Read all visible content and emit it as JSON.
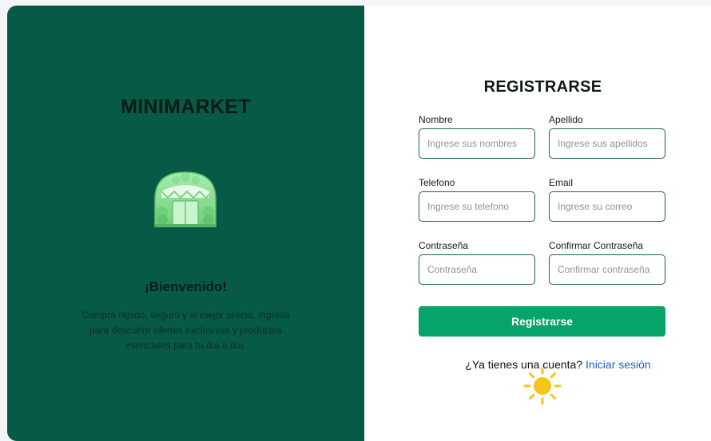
{
  "brand": {
    "name": "MINIMARKET",
    "welcome": "¡Bienvenido!",
    "description": "Compra rápido, seguro y al mejor precio. Ingresa para descubrir ofertas exclusivas y productos esenciales para tu día a día.",
    "illustration": "storefront-icon"
  },
  "form": {
    "title": "REGISTRARSE",
    "fields": [
      {
        "label": "Nombre",
        "placeholder": "Ingrese sus nombres",
        "value": ""
      },
      {
        "label": "Apellido",
        "placeholder": "Ingrese sus apellidos",
        "value": ""
      },
      {
        "label": "Telefono",
        "placeholder": "Ingrese su telefono",
        "value": ""
      },
      {
        "label": "Email",
        "placeholder": "Ingrese su correo",
        "value": ""
      },
      {
        "label": "Contraseña",
        "placeholder": "Contraseña",
        "value": ""
      },
      {
        "label": "Confirmar Contraseña",
        "placeholder": "Confirmar contraseña",
        "value": ""
      }
    ],
    "submit_label": "Registrarse",
    "login_prompt": "¿Ya tienes una cuenta?",
    "login_link": "Iniciar sesión"
  },
  "decoration": {
    "cursor_icon": "sun-icon"
  },
  "colors": {
    "panel_green": "#065a46",
    "button_green": "#05a468",
    "input_border": "#1b6150",
    "link_blue": "#1f5fbf",
    "sun_yellow": "#f5c518"
  }
}
